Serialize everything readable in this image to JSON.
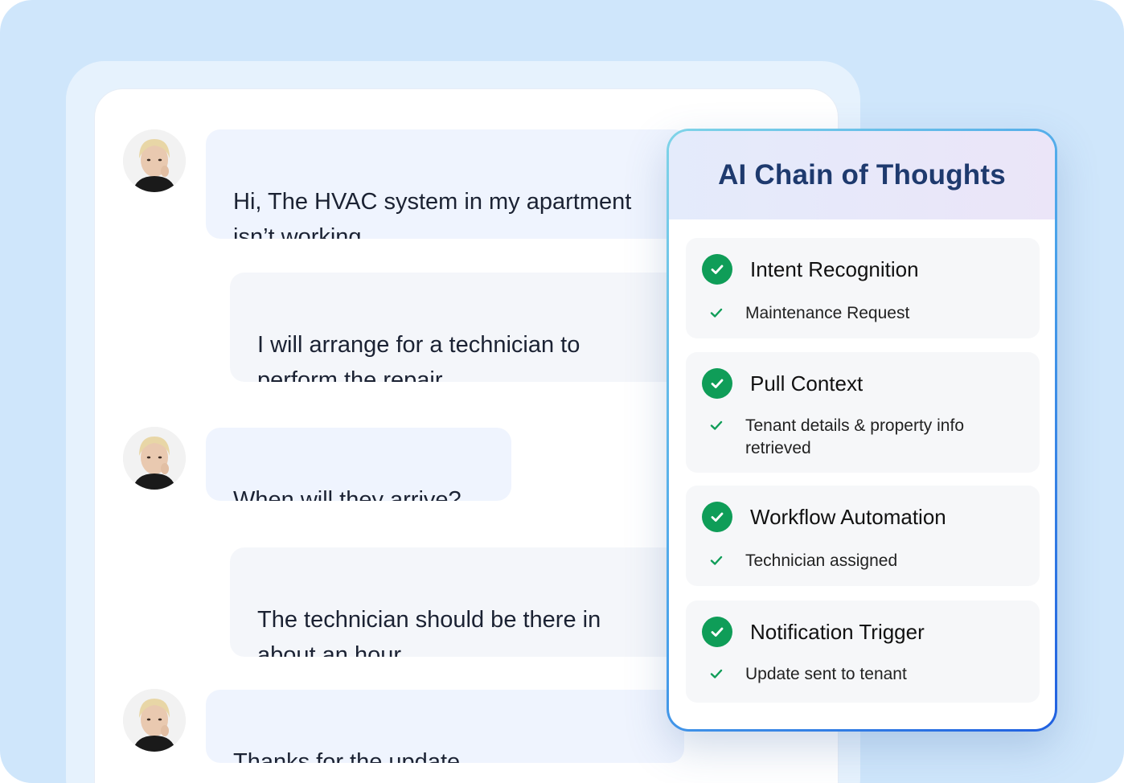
{
  "chat": {
    "messages": [
      {
        "role": "user",
        "text": "Hi, The HVAC system in my apartment isn’t working."
      },
      {
        "role": "agent",
        "text": "I will arrange for a technician to perform the repair."
      },
      {
        "role": "user",
        "text": "When will they arrive?"
      },
      {
        "role": "agent",
        "text": "The technician should be there in about an hour."
      },
      {
        "role": "user",
        "text": "Thanks for the update."
      }
    ]
  },
  "panel": {
    "title": "AI Chain of Thoughts",
    "steps": [
      {
        "title": "Intent Recognition",
        "detail": "Maintenance Request",
        "icon": "check-circle-icon"
      },
      {
        "title": "Pull Context",
        "detail": "Tenant details & property info retrieved",
        "icon": "check-circle-icon"
      },
      {
        "title": "Workflow Automation",
        "detail": "Technician assigned",
        "icon": "check-circle-icon"
      },
      {
        "title": "Notification Trigger",
        "detail": "Update sent to tenant",
        "icon": "check-circle-icon"
      }
    ]
  },
  "colors": {
    "background": "#cfe6fb",
    "user_bubble": "#eff4fe",
    "agent_bubble": "#f4f6fa",
    "check_green": "#0f9d58",
    "panel_title": "#1e3a6e",
    "panel_border": "#1f5fe0"
  }
}
